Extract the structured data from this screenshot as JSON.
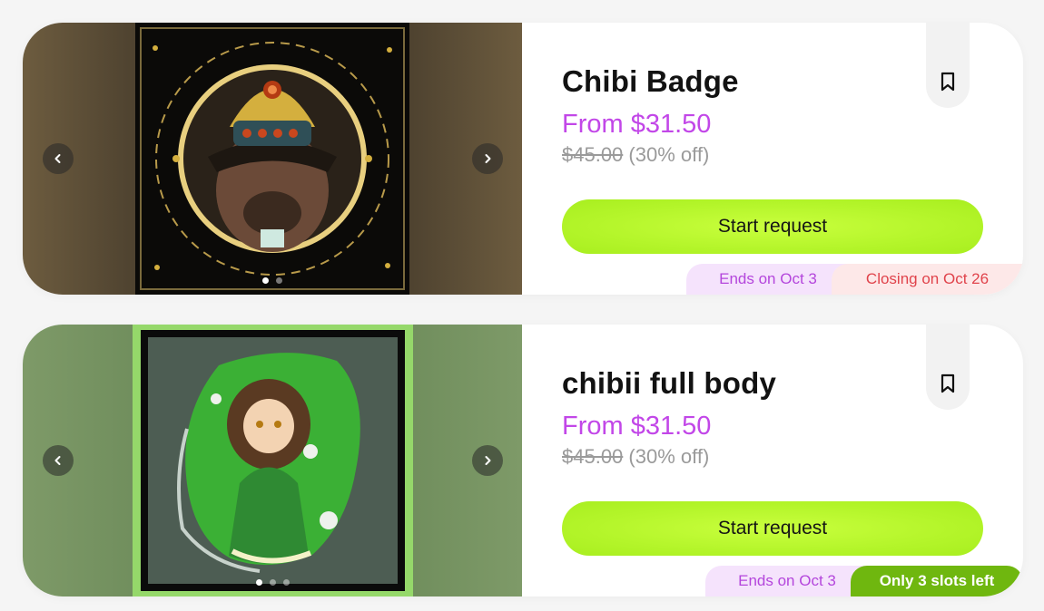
{
  "listings": [
    {
      "title": "Chibi Badge",
      "price": "From $31.50",
      "original_price": "$45.00",
      "discount": "(30% off)",
      "cta_label": "Start request",
      "badges": [
        "Ends on Oct 3",
        "Closing on Oct 26"
      ],
      "image_count": 2,
      "active_image": 1,
      "icons": [
        "chevron-left-icon",
        "chevron-right-icon",
        "bookmark-icon"
      ],
      "colors": {
        "price": "#c247e8",
        "cta": "#b4f52a",
        "ends_badge": "#f5e3fc",
        "closing_badge": "#fde8e8"
      }
    },
    {
      "title": "chibii full body",
      "price": "From $31.50",
      "original_price": "$45.00",
      "discount": "(30% off)",
      "cta_label": "Start request",
      "badges": [
        "Ends on Oct 3",
        "Only 3 slots left"
      ],
      "image_count": 3,
      "active_image": 1,
      "icons": [
        "chevron-left-icon",
        "chevron-right-icon",
        "bookmark-icon"
      ],
      "colors": {
        "price": "#c247e8",
        "cta": "#b4f52a",
        "ends_badge": "#f5e3fc",
        "slots_badge": "#6fb70f"
      }
    }
  ]
}
